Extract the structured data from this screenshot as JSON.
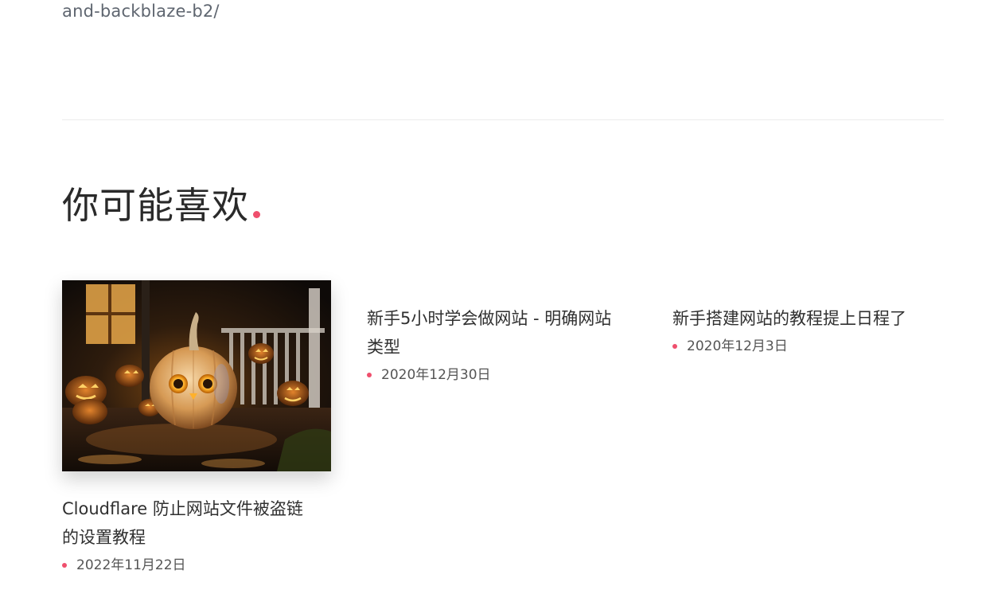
{
  "url_tail": "and-backblaze-b2/",
  "section": {
    "title": "你可能喜欢"
  },
  "cards": [
    {
      "title": "Cloudflare 防止网站文件被盗链的设置教程",
      "title_line1": "Cloudflare 防止网站文件被盗链",
      "title_line2": "的设置教程",
      "date": "2022年11月22日",
      "has_image": true,
      "image_subject": "halloween-pumpkins"
    },
    {
      "title": "新手5小时学会做网站 - 明确网站类型",
      "title_line1": "新手5小时学会做网站 - 明确网站",
      "title_line2": "类型",
      "date": "2020年12月30日",
      "has_image": false
    },
    {
      "title": "新手搭建网站的教程提上日程了",
      "title_line1": "新手搭建网站的教程提上日程了",
      "title_line2": "",
      "date": "2020年12月3日",
      "has_image": false
    }
  ],
  "colors": {
    "accent": "#ef4f6d",
    "text": "#303030",
    "muted": "#5f6670"
  }
}
